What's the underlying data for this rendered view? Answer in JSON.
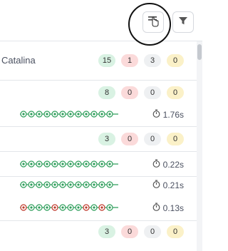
{
  "toolbar": {
    "collapse_icon": "collapse-hand-cursor-icon",
    "filter_icon": "filter-icon"
  },
  "groups": [
    {
      "label": "Catalina",
      "counts": [
        "15",
        "1",
        "3",
        "0"
      ]
    },
    {
      "label": "",
      "counts": [
        "8",
        "0",
        "0",
        "0"
      ]
    },
    {
      "label": "",
      "counts": [
        "3",
        "0",
        "0",
        "0"
      ]
    },
    {
      "label": "",
      "counts": [
        "3",
        "0",
        "0",
        "0"
      ]
    }
  ],
  "runs": [
    {
      "time": "1.76s",
      "dots": [
        "pass",
        "pass",
        "pass",
        "pass",
        "pass",
        "pass",
        "pass",
        "pass",
        "pass",
        "pass",
        "pass",
        "pass"
      ]
    },
    {
      "time": "0.22s",
      "dots": [
        "pass",
        "pass",
        "pass",
        "pass",
        "pass",
        "pass",
        "pass",
        "pass",
        "pass",
        "pass",
        "pass",
        "pass"
      ]
    },
    {
      "time": "0.21s",
      "dots": [
        "pass",
        "pass",
        "pass",
        "pass",
        "pass",
        "pass",
        "pass",
        "pass",
        "pass",
        "pass",
        "pass",
        "pass"
      ]
    },
    {
      "time": "0.13s",
      "dots": [
        "fail",
        "pass",
        "pass",
        "pass",
        "fail",
        "pass",
        "pass",
        "pass",
        "fail",
        "pass",
        "fail",
        "pass"
      ]
    }
  ],
  "colors": {
    "pass": "#2e9e5b",
    "fail": "#c0392b",
    "green_badge": "#d9f2e3",
    "red_badge": "#fbdada",
    "gray_badge": "#eef0f2",
    "yellow_badge": "#fbf1c8"
  }
}
